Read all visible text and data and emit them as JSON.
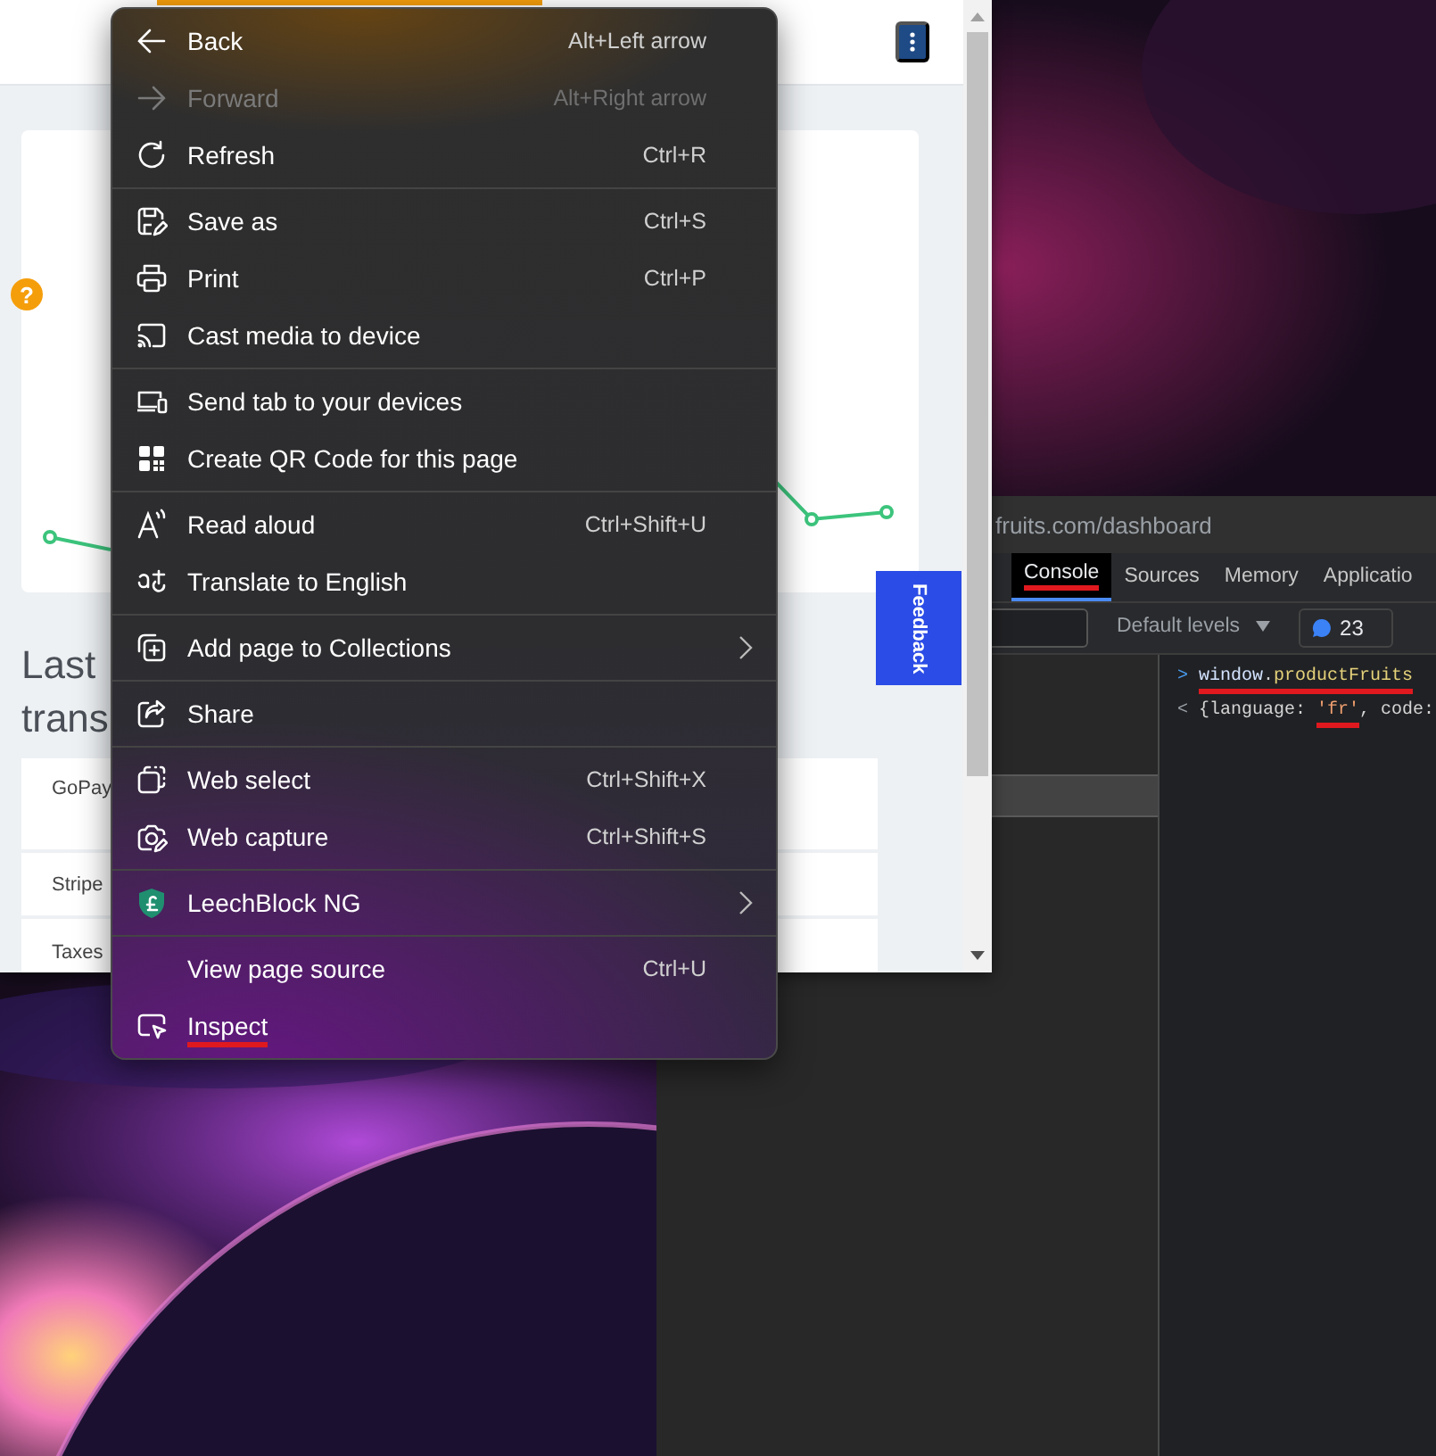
{
  "browser": {
    "help_badge": "?",
    "heading": "Last trans",
    "transactions": [
      {
        "label": "GoPay"
      },
      {
        "label": "Stripe"
      },
      {
        "label": "Taxes"
      }
    ],
    "feedback_button": "Feedback"
  },
  "devtools": {
    "url": "fruits.com/dashboard",
    "tabs": [
      {
        "label": "Console",
        "selected": true,
        "underlined": true
      },
      {
        "label": "Sources",
        "selected": false,
        "underlined": false
      },
      {
        "label": "Memory",
        "selected": false,
        "underlined": false
      },
      {
        "label": "Applicatio",
        "selected": false,
        "underlined": false
      }
    ],
    "levels_dropdown": "Default levels",
    "message_count": "23",
    "console": [
      {
        "kind": "input",
        "prompt": ">",
        "tokens": [
          {
            "text": "window",
            "kind": "global",
            "underlined": true
          },
          {
            "text": ".",
            "kind": "plain",
            "underlined": true
          },
          {
            "text": "productFruits",
            "kind": "property",
            "underlined": true
          }
        ]
      },
      {
        "kind": "output",
        "prompt": "<",
        "tokens": [
          {
            "text": "{language: ",
            "kind": "plain",
            "underlined": false
          },
          {
            "text": "'fr'",
            "kind": "string",
            "underlined": true
          },
          {
            "text": ", code:",
            "kind": "plain",
            "underlined": false
          }
        ]
      }
    ]
  },
  "context_menu": {
    "groups": [
      {
        "items": [
          {
            "label": "Back",
            "shortcut": "Alt+Left arrow",
            "disabled": false,
            "submenu": false,
            "underlined": false
          },
          {
            "label": "Forward",
            "shortcut": "Alt+Right arrow",
            "disabled": true,
            "submenu": false,
            "underlined": false
          },
          {
            "label": "Refresh",
            "shortcut": "Ctrl+R",
            "disabled": false,
            "submenu": false,
            "underlined": false
          }
        ]
      },
      {
        "items": [
          {
            "label": "Save as",
            "shortcut": "Ctrl+S",
            "disabled": false,
            "submenu": false,
            "underlined": false
          },
          {
            "label": "Print",
            "shortcut": "Ctrl+P",
            "disabled": false,
            "submenu": false,
            "underlined": false
          },
          {
            "label": "Cast media to device",
            "disabled": false,
            "submenu": false,
            "underlined": false
          }
        ]
      },
      {
        "items": [
          {
            "label": "Send tab to your devices",
            "disabled": false,
            "submenu": false,
            "underlined": false
          },
          {
            "label": "Create QR Code for this page",
            "disabled": false,
            "submenu": false,
            "underlined": false
          }
        ]
      },
      {
        "items": [
          {
            "label": "Read aloud",
            "shortcut": "Ctrl+Shift+U",
            "disabled": false,
            "submenu": false,
            "underlined": false
          },
          {
            "label": "Translate to English",
            "disabled": false,
            "submenu": false,
            "underlined": false
          }
        ]
      },
      {
        "items": [
          {
            "label": "Add page to Collections",
            "disabled": false,
            "submenu": true,
            "underlined": false
          }
        ]
      },
      {
        "items": [
          {
            "label": "Share",
            "disabled": false,
            "submenu": false,
            "underlined": false
          }
        ]
      },
      {
        "items": [
          {
            "label": "Web select",
            "shortcut": "Ctrl+Shift+X",
            "disabled": false,
            "submenu": false,
            "underlined": false
          },
          {
            "label": "Web capture",
            "shortcut": "Ctrl+Shift+S",
            "disabled": false,
            "submenu": false,
            "underlined": false
          }
        ]
      },
      {
        "items": [
          {
            "label": "LeechBlock NG",
            "disabled": false,
            "submenu": true,
            "underlined": false
          }
        ]
      },
      {
        "items": [
          {
            "label": "View page source",
            "shortcut": "Ctrl+U",
            "disabled": false,
            "submenu": false,
            "underlined": false
          },
          {
            "label": "Inspect",
            "disabled": false,
            "submenu": false,
            "underlined": true
          }
        ]
      }
    ]
  }
}
